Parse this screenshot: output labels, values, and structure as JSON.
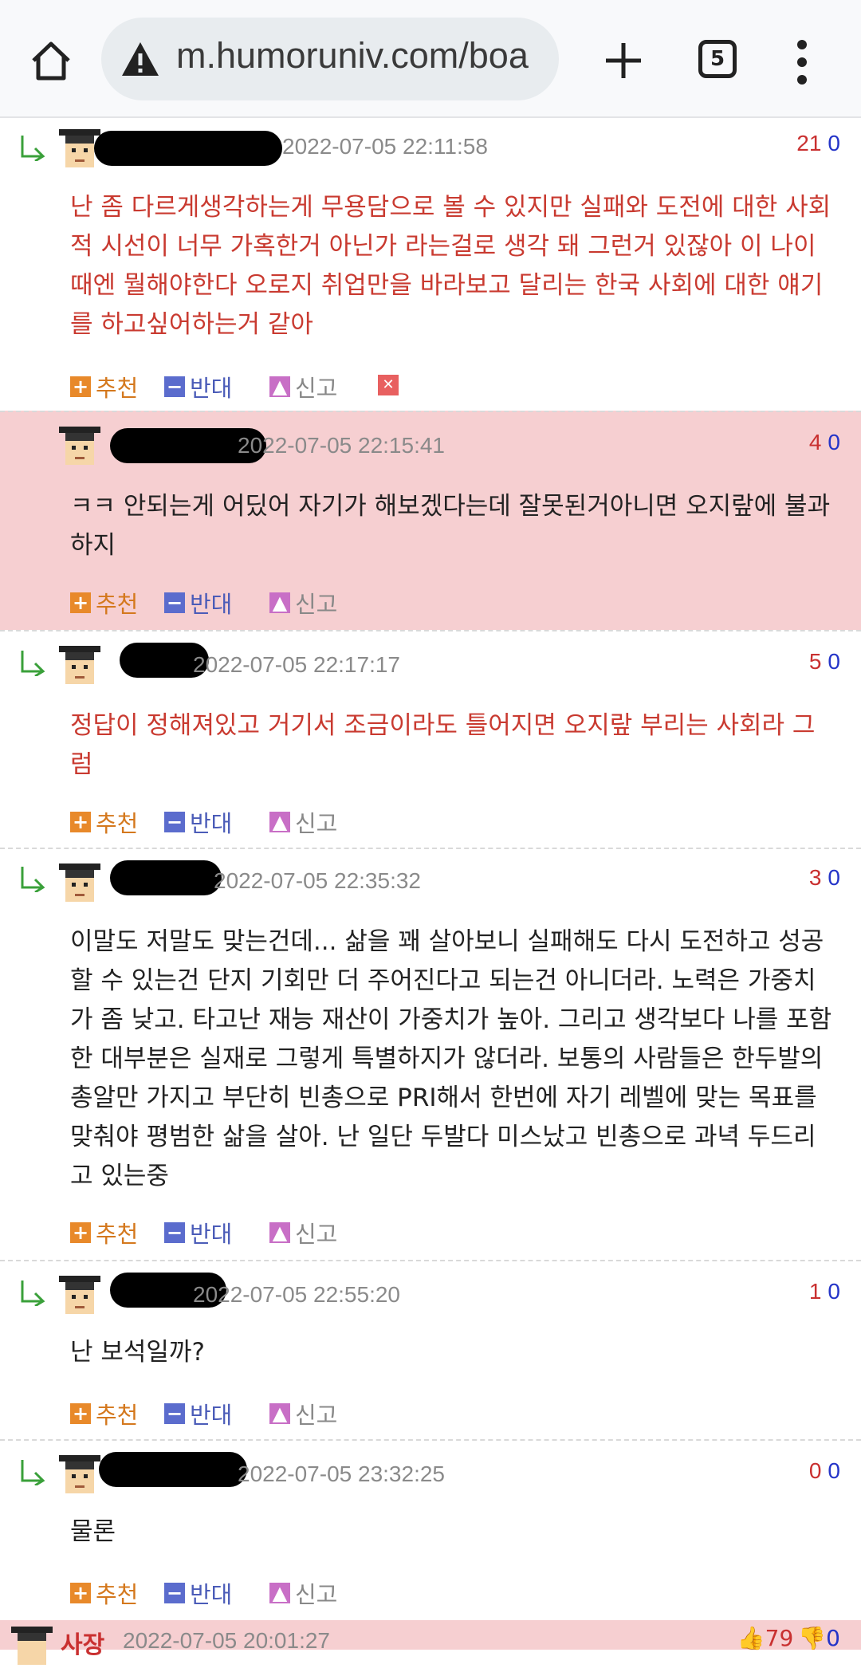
{
  "browser": {
    "url": "m.humoruniv.com/boa",
    "tab_count": "5"
  },
  "labels": {
    "recommend": "추천",
    "oppose": "반대",
    "report": "신고"
  },
  "comments": [
    {
      "date": "2022-07-05 22:11:58",
      "up": "21",
      "down": "0",
      "text": "난 좀 다르게생각하는게 무용담으로 볼 수 있지만 실패와 도전에 대한 사회적 시선이 너무 가혹한거 아닌가 라는걸로 생각 돼 그런거 있잖아 이 나이 때엔 뭘해야한다 오로지 취업만을 바라보고 달리는 한국 사회에 대한 얘기를 하고싶어하는거 같아"
    },
    {
      "date": "2022-07-05 22:15:41",
      "up": "4",
      "down": "0",
      "text": "ㅋㅋ 안되는게 어딨어 자기가 해보겠다는데 잘못된거아니면 오지랖에 불과하지"
    },
    {
      "date": "2022-07-05 22:17:17",
      "up": "5",
      "down": "0",
      "text": "정답이 정해져있고 거기서 조금이라도 틀어지면 오지랖 부리는 사회라 그럼"
    },
    {
      "date": "2022-07-05 22:35:32",
      "up": "3",
      "down": "0",
      "text": "이말도 저말도 맞는건데... 삶을 꽤 살아보니 실패해도 다시 도전하고 성공할 수 있는건 단지 기회만 더 주어진다고 되는건 아니더라. 노력은 가중치가 좀 낮고. 타고난 재능 재산이 가중치가 높아. 그리고 생각보다 나를 포함한 대부분은 실재로 그렇게 특별하지가 않더라. 보통의 사람들은 한두발의 총알만 가지고 부단히 빈총으로 PRI해서 한번에 자기 레벨에 맞는 목표를 맞춰야 평범한 삶을 살아. 난 일단 두발다 미스났고 빈총으로 과녁 두드리고 있는중"
    },
    {
      "date": "2022-07-05 22:55:20",
      "up": "1",
      "down": "0",
      "text": "난 보석일까?"
    },
    {
      "date": "2022-07-05 23:32:25",
      "up": "0",
      "down": "0",
      "text": "물론"
    }
  ],
  "last_comment": {
    "author": "사장",
    "date": "2022-07-05 20:01:27",
    "up": "79",
    "down": "0"
  },
  "colors": {
    "pink_highlight": "#f6cfd1",
    "red_text": "#c93a30",
    "up_red": "#c93030",
    "down_blue": "#2434c8"
  }
}
